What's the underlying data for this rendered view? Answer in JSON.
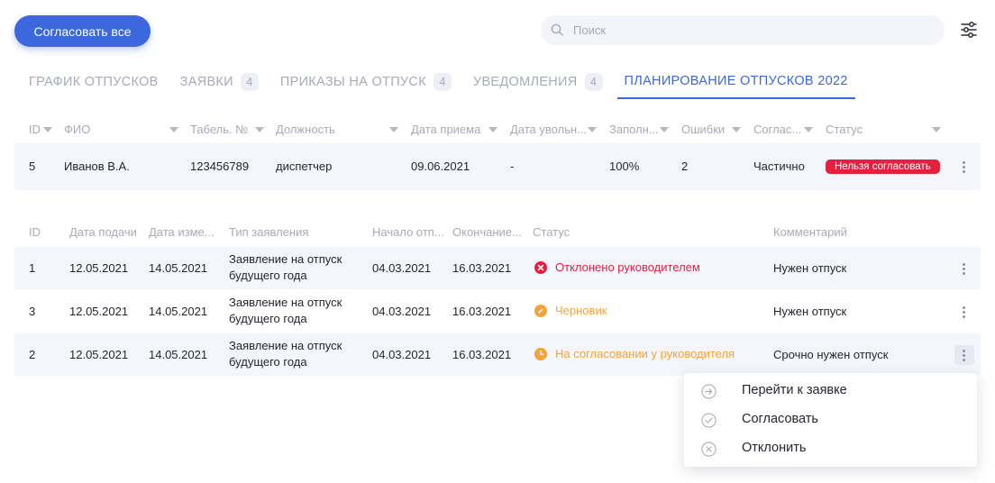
{
  "toolbar": {
    "approve_all_label": "Согласовать все",
    "search_placeholder": "Поиск",
    "filter_icon": "sliders-icon"
  },
  "tabs": [
    {
      "label": "ГРАФИК ОТПУСКОВ",
      "badge": null,
      "active": false
    },
    {
      "label": "ЗАЯВКИ",
      "badge": "4",
      "active": false
    },
    {
      "label": "ПРИКАЗЫ НА ОТПУСК",
      "badge": "4",
      "active": false
    },
    {
      "label": "УВЕДОМЛЕНИЯ",
      "badge": "4",
      "active": false
    },
    {
      "label": "ПЛАНИРОВАНИЕ ОТПУСКОВ 2022",
      "badge": null,
      "active": true
    }
  ],
  "employees_table": {
    "columns": [
      "ID",
      "ФИО",
      "Табель. №",
      "Должность",
      "Дата приема",
      "Дата увольн...",
      "Заполн...",
      "Ошибки",
      "Соглас...",
      "Статус"
    ],
    "rows": [
      {
        "id": "5",
        "name": "Иванов В.А.",
        "tabel": "123456789",
        "position": "диспетчер",
        "hire_date": "09.06.2021",
        "fire_date": "-",
        "filled": "100%",
        "errors": "2",
        "agreed": "Частично",
        "status": "Нельзя согласовать"
      }
    ]
  },
  "applications_table": {
    "columns": [
      "ID",
      "Дата подачи",
      "Дата изме...",
      "Тип заявления",
      "Начало отп...",
      "Окончание...",
      "Статус",
      "Комментарий"
    ],
    "rows": [
      {
        "id": "1",
        "submitted": "12.05.2021",
        "changed": "14.05.2021",
        "type_line1": "Заявление на отпуск",
        "type_line2": "будущего года",
        "start": "04.03.2021",
        "end": "16.03.2021",
        "status": "Отклонено руководителем",
        "status_kind": "rejected",
        "comment": "Нужен отпуск"
      },
      {
        "id": "3",
        "submitted": "12.05.2021",
        "changed": "14.05.2021",
        "type_line1": "Заявление на отпуск",
        "type_line2": "будущего года",
        "start": "04.03.2021",
        "end": "16.03.2021",
        "status": "Черновик",
        "status_kind": "draft",
        "comment": "Нужен отпуск"
      },
      {
        "id": "2",
        "submitted": "12.05.2021",
        "changed": "14.05.2021",
        "type_line1": "Заявление на отпуск",
        "type_line2": "будущего года",
        "start": "04.03.2021",
        "end": "16.03.2021",
        "status": "На согласовании у руководителя",
        "status_kind": "pending",
        "comment": "Срочно нужен отпуск"
      }
    ]
  },
  "context_menu": {
    "items": [
      {
        "label": "Перейти к заявке",
        "icon": "arrow-right-circle-icon"
      },
      {
        "label": "Согласовать",
        "icon": "check-circle-icon"
      },
      {
        "label": "Отклонить",
        "icon": "x-circle-icon"
      }
    ]
  },
  "colors": {
    "accent": "#3d68dd",
    "danger": "#e5203f",
    "warning": "#f2a33a",
    "muted_text": "#a5abba",
    "row_tint": "#f4f6fb"
  }
}
